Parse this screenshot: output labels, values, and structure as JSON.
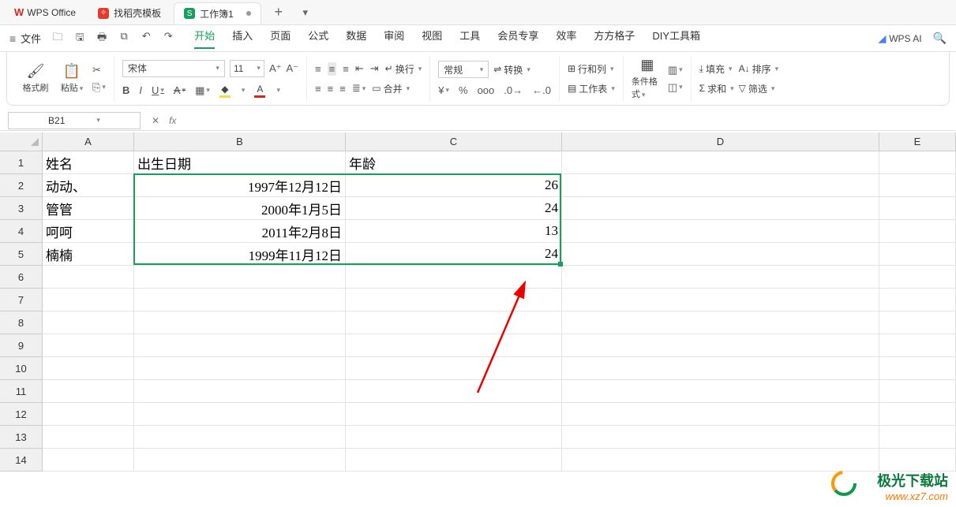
{
  "app": {
    "name": "WPS Office"
  },
  "tabs": {
    "template": {
      "label": "找稻壳模板",
      "iconColor": "#e33a2e"
    },
    "workbook": {
      "label": "工作簿1",
      "iconLetter": "S",
      "iconColor": "#1a9e5c"
    }
  },
  "menu": {
    "file": "文件",
    "items": [
      "开始",
      "插入",
      "页面",
      "公式",
      "数据",
      "审阅",
      "视图",
      "工具",
      "会员专享",
      "效率",
      "方方格子",
      "DIY工具箱"
    ],
    "activeIndex": 0,
    "ai": "WPS AI"
  },
  "ribbon": {
    "formatBrush": "格式刷",
    "paste": "粘贴",
    "fontName": "宋体",
    "fontSize": "11",
    "numberFormat": "常规",
    "convert": "转换",
    "wrap": "换行",
    "merge": "合并",
    "rowsCols": "行和列",
    "worksheet": "工作表",
    "condFormat": "条件格式",
    "fill": "填充",
    "sum": "求和",
    "sort": "排序",
    "filter": "筛选"
  },
  "namebox": {
    "ref": "B21"
  },
  "sheet": {
    "colWidths": {
      "A": 116,
      "B": 268,
      "C": 274,
      "D": 402,
      "E": 97
    },
    "columns": [
      "A",
      "B",
      "C",
      "D",
      "E"
    ],
    "rowCount": 14,
    "headers": {
      "A": "姓名",
      "B": "出生日期",
      "C": "年龄"
    },
    "data": [
      {
        "A": "动动、",
        "B": "1997年12月12日",
        "C": "26"
      },
      {
        "A": "管管",
        "B": "2000年1月5日",
        "C": "24"
      },
      {
        "A": "呵呵",
        "B": "2011年2月8日",
        "C": "13"
      },
      {
        "A": "楠楠",
        "B": "1999年11月12日",
        "C": "24"
      }
    ]
  },
  "watermark": {
    "line1": "极光下载站",
    "line2": "www.xz7.com"
  }
}
